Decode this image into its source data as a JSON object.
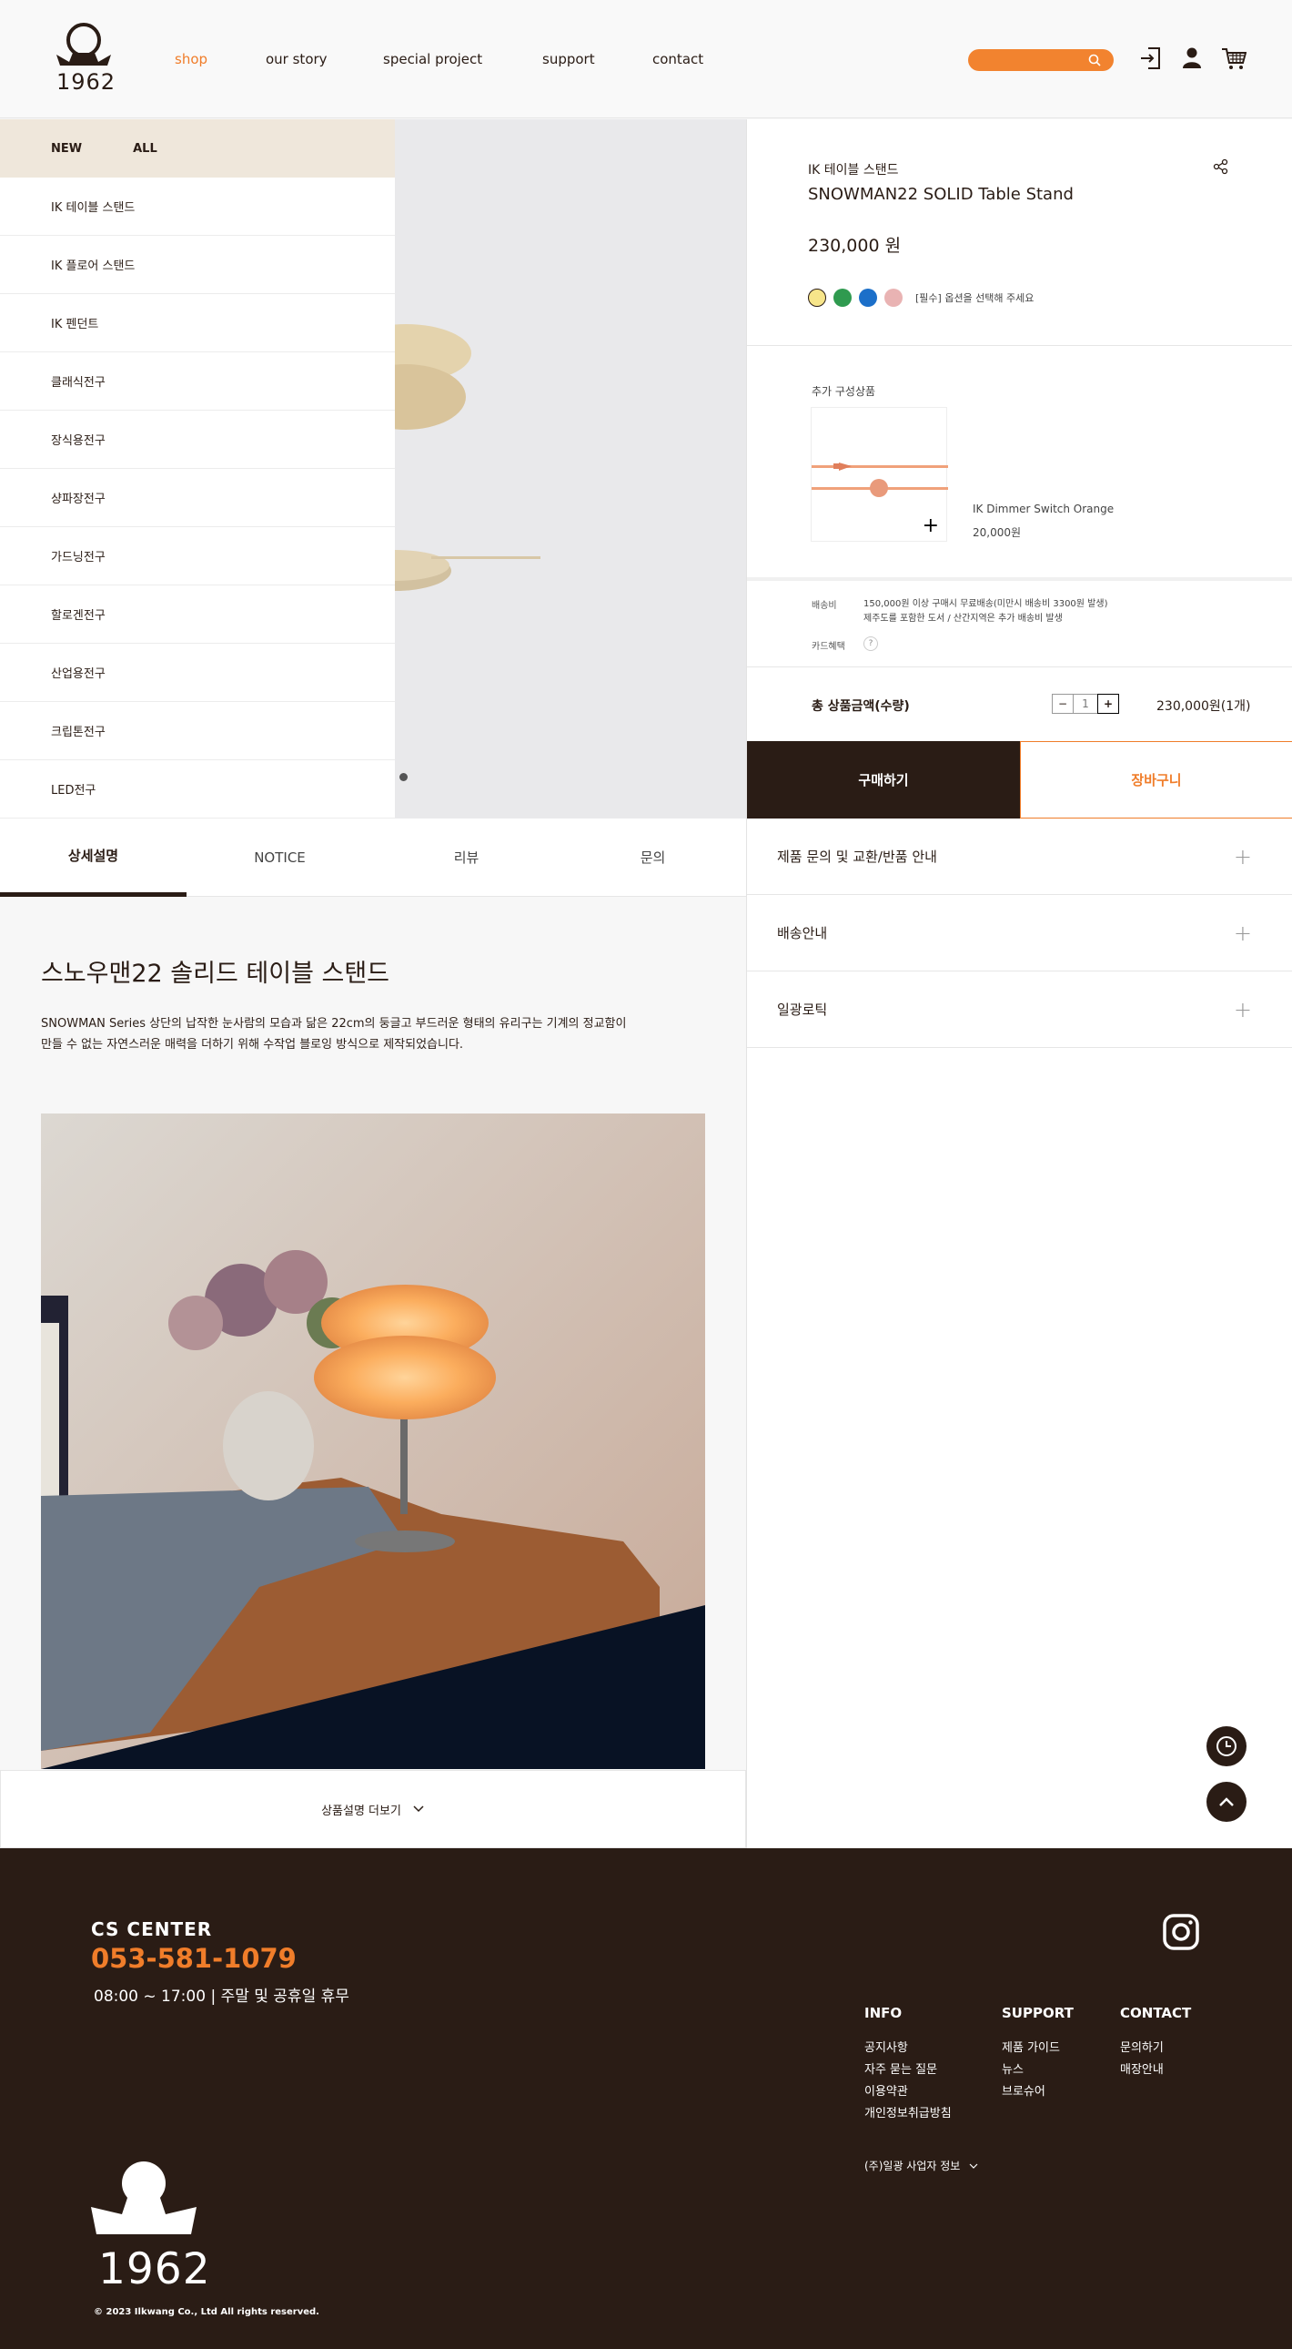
{
  "header": {
    "logo_year": "1962",
    "nav": [
      "shop",
      "our story",
      "special project",
      "support",
      "contact"
    ],
    "accent": "#f07d2a",
    "icons": [
      "login-icon",
      "user-icon",
      "cart-icon"
    ]
  },
  "categories": {
    "head": [
      "NEW",
      "ALL"
    ],
    "items": [
      "IK 테이블 스탠드",
      "IK 플로어 스탠드",
      "IK 펜던트",
      "클래식전구",
      "장식용전구",
      "샹파장전구",
      "가드닝전구",
      "할로겐전구",
      "산업용전구",
      "크립톤전구",
      "LED전구"
    ]
  },
  "product": {
    "category": "IK 테이블 스탠드",
    "name": "SNOWMAN22 SOLID Table Stand",
    "price": "230,000 원",
    "swatch_colors": [
      "#f7e58a",
      "#2f9a4f",
      "#1b6fc9",
      "#e9b3b3"
    ],
    "option_note": "[필수] 옵션을 선택해 주세요",
    "addon_title": "추가 구성상품",
    "addon_name": "IK Dimmer Switch Orange",
    "addon_price": "20,000원",
    "shipping_label": "배송비",
    "shipping_line1": "150,000원 이상 구매시 무료배송(미만시 배송비 3300원 발생)",
    "shipping_line2": "제주도를 포함한 도서 / 산간지역은 추가 배송비 발생",
    "card_label": "카드혜택",
    "card_help": "?",
    "total_label": "총 상품금액(수량)",
    "qty_minus": "−",
    "qty": "1",
    "qty_plus": "+",
    "total_value": "230,000원(1개)",
    "buy_label": "구매하기",
    "cart_label": "장바구니"
  },
  "tabs": [
    "상세설명",
    "NOTICE",
    "리뷰",
    "문의"
  ],
  "detail": {
    "title": "스노우맨22 솔리드 테이블 스탠드",
    "desc_line1": "SNOWMAN Series 상단의 납작한 눈사람의 모습과 닮은 22cm의 둥글고 부드러운 형태의 유리구는 기계의 정교함이",
    "desc_line2": "만들 수 없는 자연스러운 매력을 더하기 위해 수작업 블로잉 방식으로 제작되었습니다.",
    "more_label": "상품설명 더보기"
  },
  "accordion": [
    "제품 문의 및 교환/반품 안내",
    "배송안내",
    "일광로틱"
  ],
  "footer": {
    "cs_title": "CS  CENTER",
    "cs_phone": "053-581-1079",
    "cs_hours": "08:00 ~ 17:00  |  주말 및 공휴일 휴무",
    "info_head": "INFO",
    "info_items": [
      "공지사항",
      "자주 묻는 질문",
      "이용약관",
      "개인정보취급방침"
    ],
    "support_head": "SUPPORT",
    "support_items": [
      "제품 가이드",
      "뉴스",
      "브로슈어"
    ],
    "contact_head": "CONTACT",
    "contact_items": [
      "문의하기",
      "매장안내"
    ],
    "business_info": "(주)일광 사업자 정보",
    "logo_year": "1962",
    "copyright": "© 2023 Ilkwang Co., Ltd All rights reserved."
  }
}
